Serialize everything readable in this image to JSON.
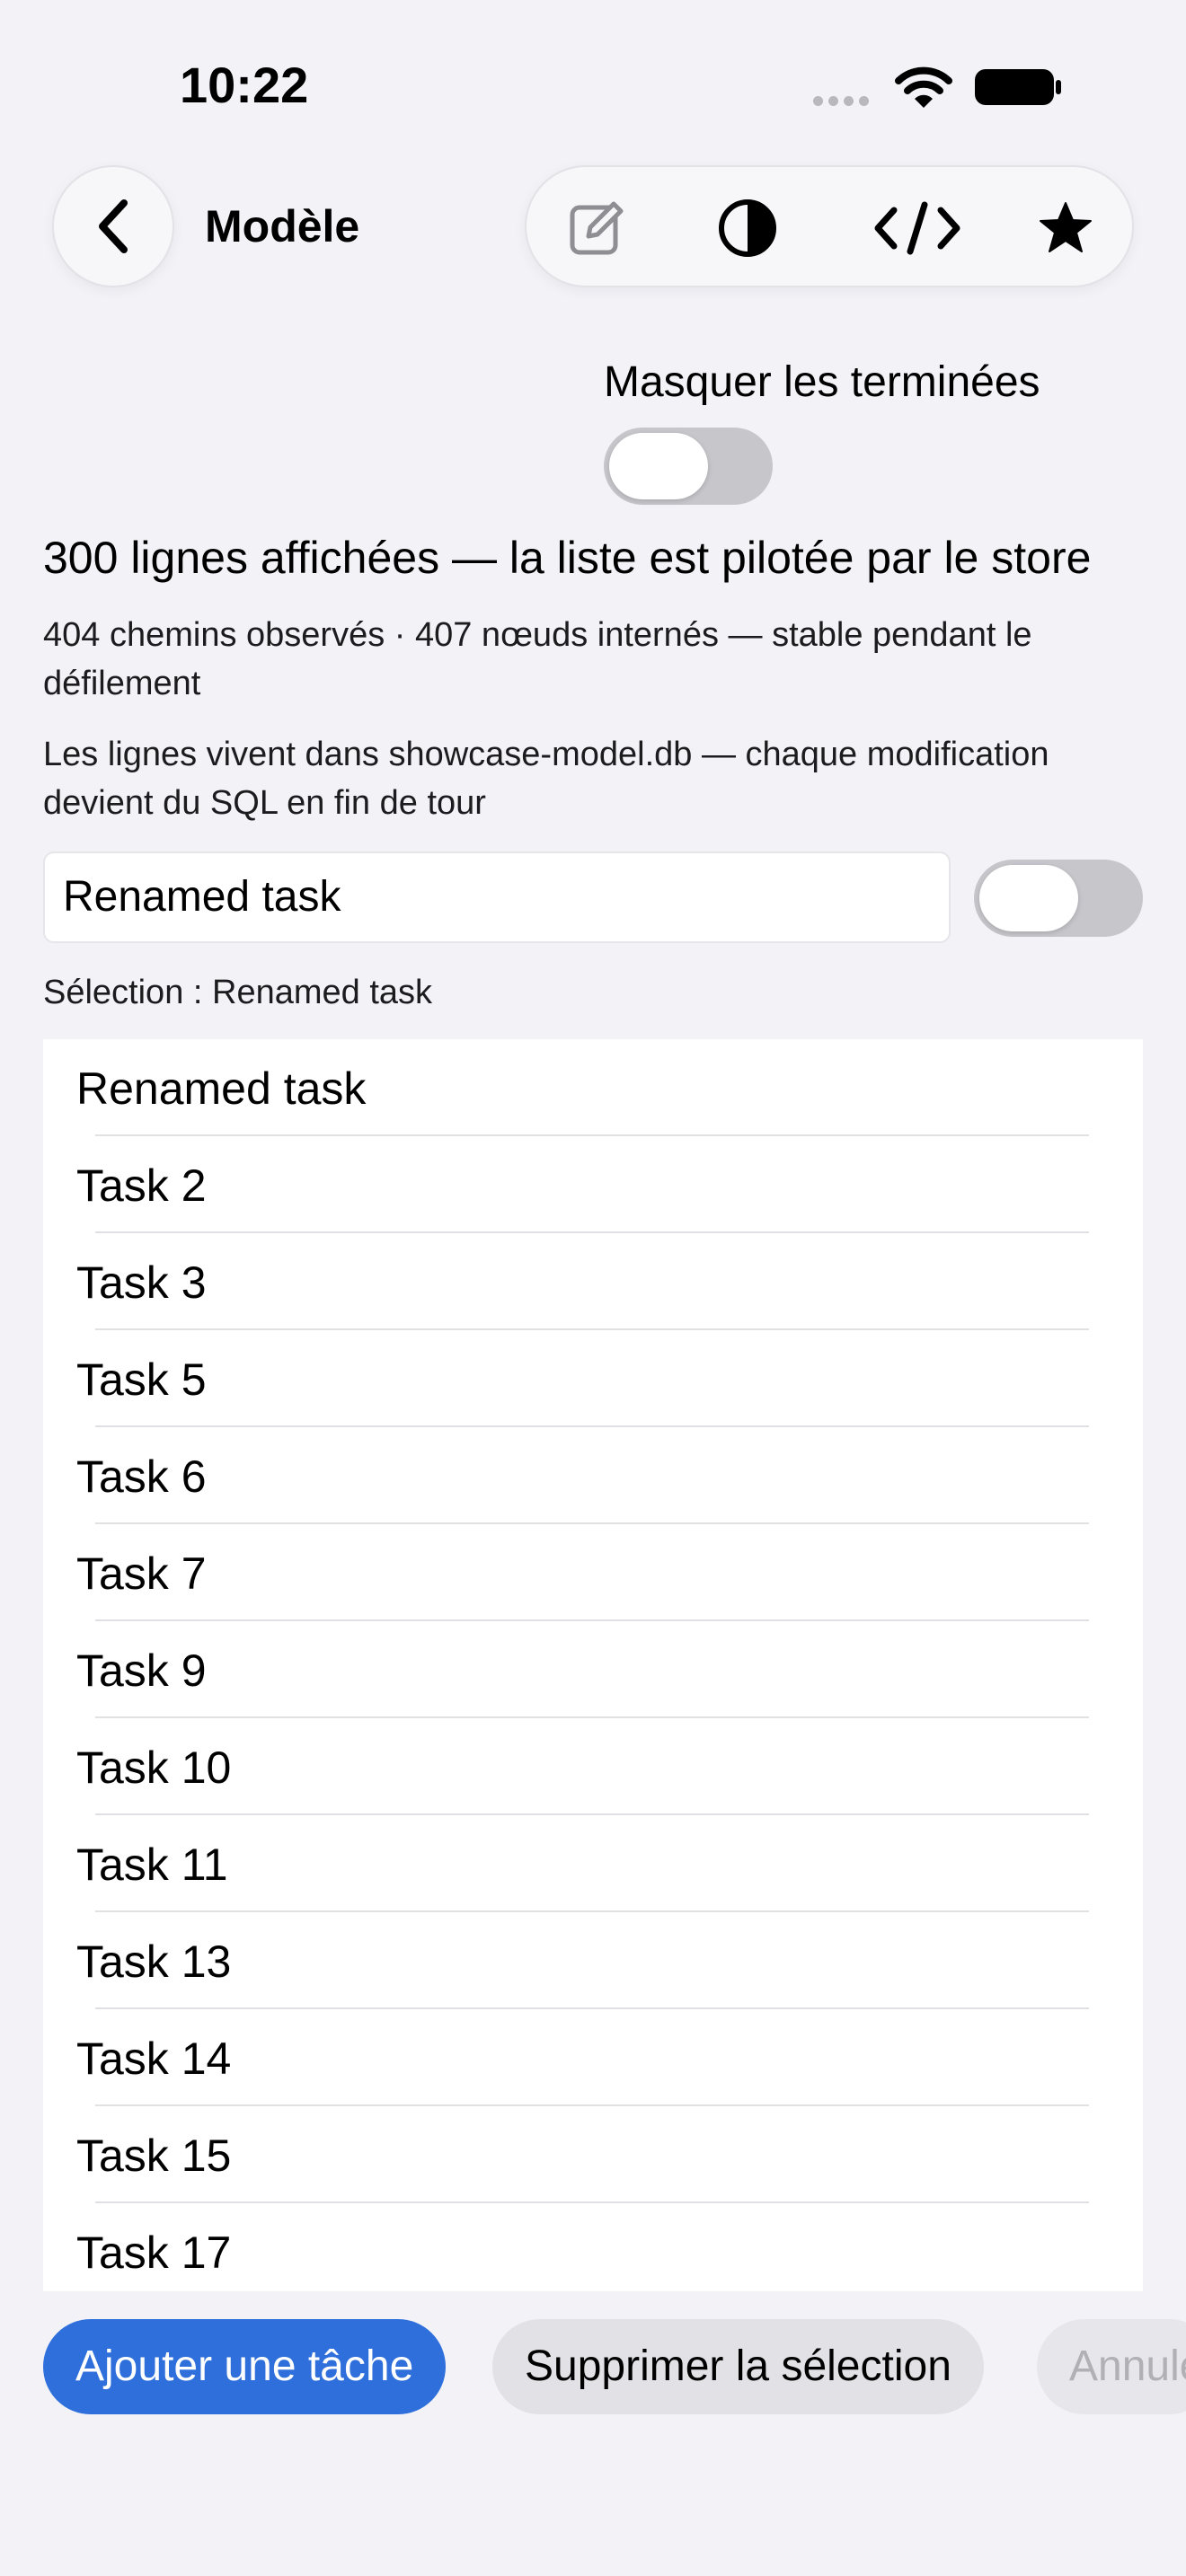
{
  "status_bar": {
    "time": "10:22"
  },
  "nav": {
    "title": "Modèle",
    "icons": [
      "chevron-left-icon",
      "compose-icon",
      "contrast-icon",
      "code-icon",
      "star-icon"
    ]
  },
  "filter": {
    "label": "Masquer les terminées",
    "toggle_on": false
  },
  "summary": {
    "rows_line": "300 lignes affichées — la liste est pilotée par le store",
    "paths_line": "404 chemins observés · 407 nœuds internés — stable pendant le défilement",
    "storage_line": "Les lignes vivent dans showcase-model.db — chaque modification devient du SQL en fin de tour"
  },
  "editor": {
    "field_value": "Renamed task",
    "toggle_on": false,
    "selection_text": "Sélection : Renamed task"
  },
  "list": {
    "items": [
      "Renamed task",
      "Task 2",
      "Task 3",
      "Task 5",
      "Task 6",
      "Task 7",
      "Task 9",
      "Task 10",
      "Task 11",
      "Task 13",
      "Task 14",
      "Task 15",
      "Task 17"
    ]
  },
  "actions": {
    "add_label": "Ajouter une tâche",
    "delete_label": "Supprimer la sélection",
    "undo_label": "Annuler"
  },
  "colors": {
    "accent": "#2f6fdc",
    "background": "#f2f2f7"
  }
}
